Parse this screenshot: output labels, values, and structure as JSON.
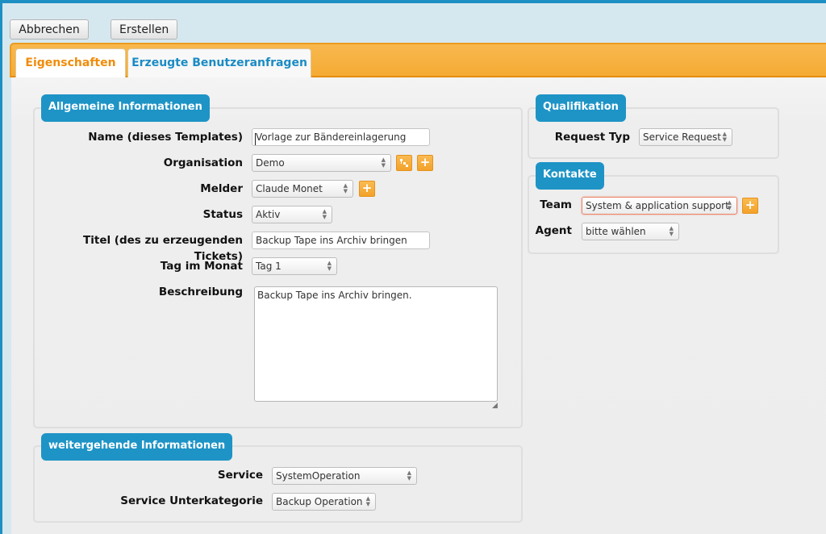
{
  "toolbar": {
    "cancel_label": "Abbrechen",
    "create_label": "Erstellen"
  },
  "tabs": [
    {
      "label": "Eigenschaften",
      "active": true
    },
    {
      "label": "Erzeugte Benutzeranfragen",
      "active": false
    }
  ],
  "general": {
    "legend": "Allgemeine Informationen",
    "name_label": "Name (dieses Templates)",
    "name_value": "Vorlage zur Bändereinlagerung",
    "organisation_label": "Organisation",
    "organisation_value": "Demo",
    "melder_label": "Melder",
    "melder_value": "Claude Monet",
    "status_label": "Status",
    "status_value": "Aktiv",
    "title_label": "Titel (des zu erzeugenden Tickets)",
    "title_value": "Backup Tape ins Archiv bringen",
    "day_label": "Tag im Monat",
    "day_value": "Tag 1",
    "description_label": "Beschreibung",
    "description_value": "Backup Tape ins Archiv bringen."
  },
  "further": {
    "legend": "weitergehende Informationen",
    "service_label": "Service",
    "service_value": "SystemOperation",
    "subcategory_label": "Service Unterkategorie",
    "subcategory_value": "Backup Operation"
  },
  "qualification": {
    "legend": "Qualifikation",
    "request_type_label": "Request Typ",
    "request_type_value": "Service Request"
  },
  "contacts": {
    "legend": "Kontakte",
    "team_label": "Team",
    "team_value": "System & application support",
    "agent_label": "Agent",
    "agent_value": "bitte wählen"
  },
  "icons": {
    "add": "+",
    "select_arrows": "▲▼",
    "resize_grip": "◢"
  },
  "colors": {
    "accent_blue": "#1e94c6",
    "accent_orange": "#f5ab34",
    "active_tab_text": "#f08c0a"
  }
}
